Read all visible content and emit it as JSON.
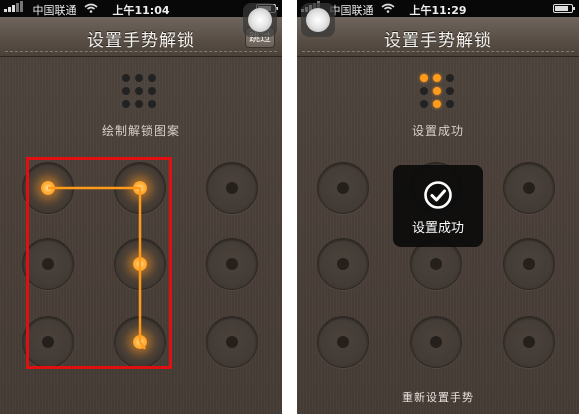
{
  "left": {
    "status": {
      "carrier": "中国联通",
      "time": "上午11:04"
    },
    "nav": {
      "title": "设置手势解锁",
      "skip": "跳过"
    },
    "caption": "绘制解锁图案",
    "active_nodes": [
      0,
      1,
      4,
      7
    ],
    "path": [
      0,
      1,
      4,
      7
    ]
  },
  "right": {
    "status": {
      "carrier": "中国联通",
      "time": "上午11:29"
    },
    "nav": {
      "title": "设置手势解锁"
    },
    "caption": "设置成功",
    "active_nodes": [],
    "mini_on": [
      0,
      1,
      4,
      7
    ],
    "toast": "设置成功",
    "reset": "重新设置手势"
  },
  "colors": {
    "accent": "#ff9a1a",
    "highlight": "#e01010",
    "toast_bg": "#0a0a0a"
  },
  "icons": {
    "signal": "signal-bars-icon",
    "wifi": "wifi-icon",
    "battery": "battery-icon",
    "assistive_touch": "assistive-touch-icon",
    "pattern_preview": "pattern-grid-icon",
    "toast": "checkmark-circle-icon"
  }
}
